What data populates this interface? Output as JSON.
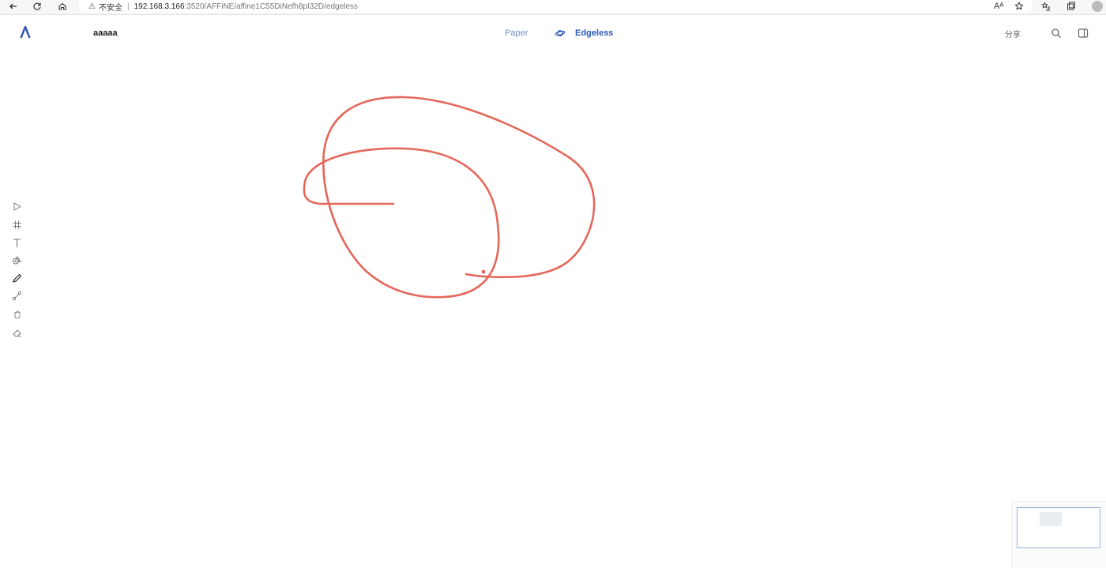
{
  "browser": {
    "back_icon": "back-arrow-icon",
    "reload_icon": "reload-icon",
    "home_icon": "home-icon",
    "security_warning": "⚠",
    "security_label": "不安全",
    "separator": "|",
    "url_host": "192.168.3.166",
    "url_rest": ":3520/AFFiNE/affine1C55DiNefh8pI32D/edgeless",
    "read_aloud_label": "Aᴬ",
    "favorite_icon": "favorite-star-icon",
    "favorites_list_icon": "favorites-list-icon",
    "collections_icon": "collections-icon",
    "profile_icon": "profile-avatar"
  },
  "header": {
    "doc_title": "aaaaa",
    "mode_paper_label": "Paper",
    "mode_edgeless_label": "Edgeless",
    "share_label": "分享",
    "search_icon": "search-icon",
    "sidebar_icon": "sidebar-toggle-icon"
  },
  "toolbar": {
    "tools": [
      {
        "name": "select",
        "icon": "pointer-icon"
      },
      {
        "name": "frame",
        "icon": "hashtag-frame-icon"
      },
      {
        "name": "text",
        "icon": "text-icon"
      },
      {
        "name": "shape",
        "icon": "shape-icon"
      },
      {
        "name": "pen",
        "icon": "pen-icon",
        "active": true
      },
      {
        "name": "connector",
        "icon": "connector-icon"
      },
      {
        "name": "hand",
        "icon": "hand-icon"
      },
      {
        "name": "eraser",
        "icon": "eraser-icon"
      }
    ]
  },
  "canvas": {
    "stroke_color": "#e5675b"
  },
  "colors": {
    "accent": "#2a56b8",
    "paper_tab": "#6f8fc8",
    "stroke": "#e5675b"
  }
}
